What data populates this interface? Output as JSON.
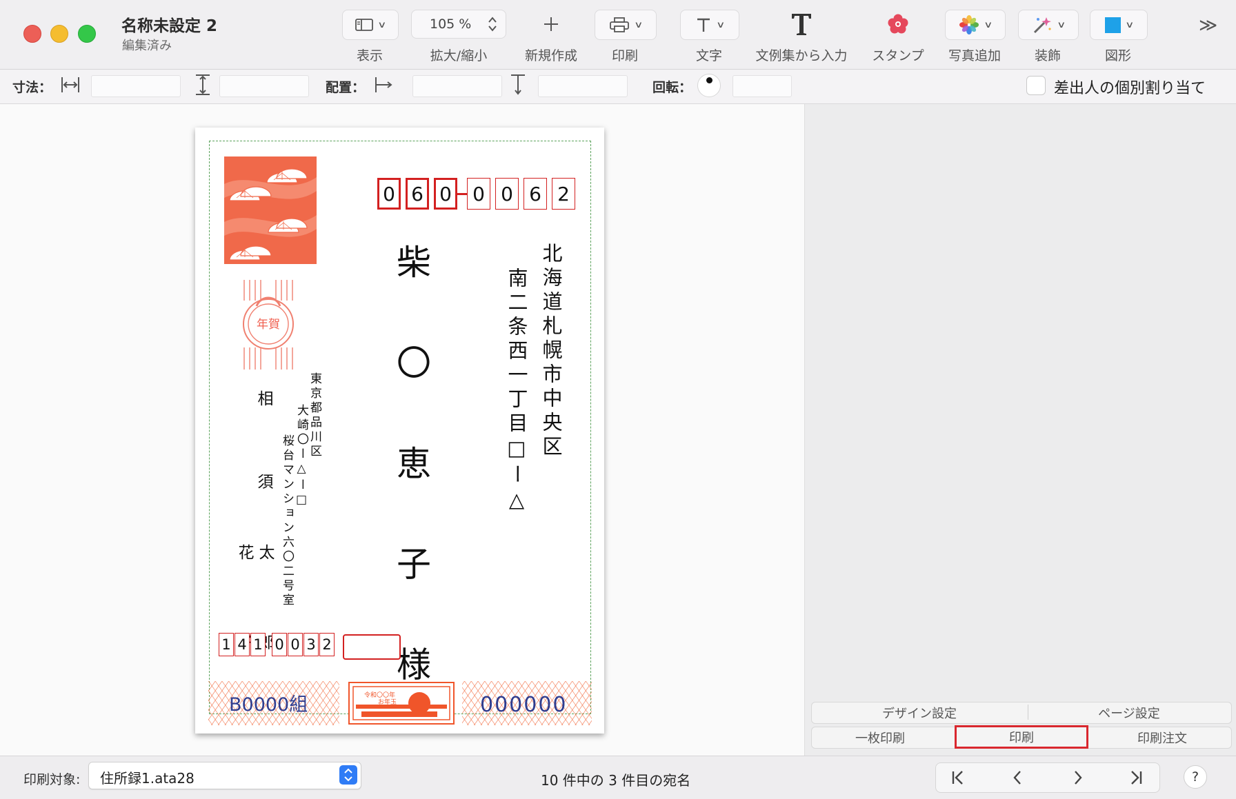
{
  "window": {
    "title": "名称未設定 2",
    "subtitle": "編集済み"
  },
  "toolbar": {
    "view_label": "表示",
    "zoom_value": "105 %",
    "zoom_label": "拡大/縮小",
    "new_label": "新規作成",
    "print_label": "印刷",
    "text_label": "文字",
    "template_text_label": "文例集から入力",
    "stamp_label": "スタンプ",
    "photo_label": "写真追加",
    "decoration_label": "装飾",
    "shape_label": "図形"
  },
  "inspector": {
    "size_label": "寸法：",
    "position_label": "配置：",
    "rotation_label": "回転：",
    "sender_checkbox_label": "差出人の個別割り当て",
    "sender_checkbox_checked": false
  },
  "postcard": {
    "recipient_zip": [
      "0",
      "6",
      "0",
      "0",
      "0",
      "6",
      "2"
    ],
    "recipient_address_line1": "北海道札幌市中央区",
    "recipient_address_line2": "南二条西一丁目□ー△",
    "recipient_name": "柴 〇 恵 子 様",
    "sender_address_line1": "東京都品川区",
    "sender_address_line2": "大崎〇ー△ー□",
    "sender_address_line3": "桜台マンション六〇二号室",
    "sender_surname": "相 須",
    "sender_given_names_1": "花 子",
    "sender_given_names_2": "太 郎",
    "sender_zip": [
      "1",
      "4",
      "1",
      "0",
      "0",
      "3",
      "2"
    ],
    "stamp_label": "年賀",
    "lottery_group": "B0000組",
    "lottery_number": "000000",
    "otoshidama_text_1": "令和〇〇年",
    "otoshidama_text_2": "お年玉"
  },
  "sidebar": {
    "tabs_row1": [
      "デザイン設定",
      "ページ設定"
    ],
    "tabs_row2": [
      "一枚印刷",
      "印刷",
      "印刷注文"
    ]
  },
  "footer": {
    "print_target_label": "印刷対象:",
    "print_target_value": "住所録1.ata28",
    "record_status": "10 件中の 3 件目の宛名",
    "help_label": "?"
  },
  "colors": {
    "accent_red": "#d32020",
    "highlight_box": "#d9272e",
    "stamp_orange": "#f0694a",
    "lottery_blue": "#2f3d8f",
    "select_blue": "#2f7cf6"
  }
}
